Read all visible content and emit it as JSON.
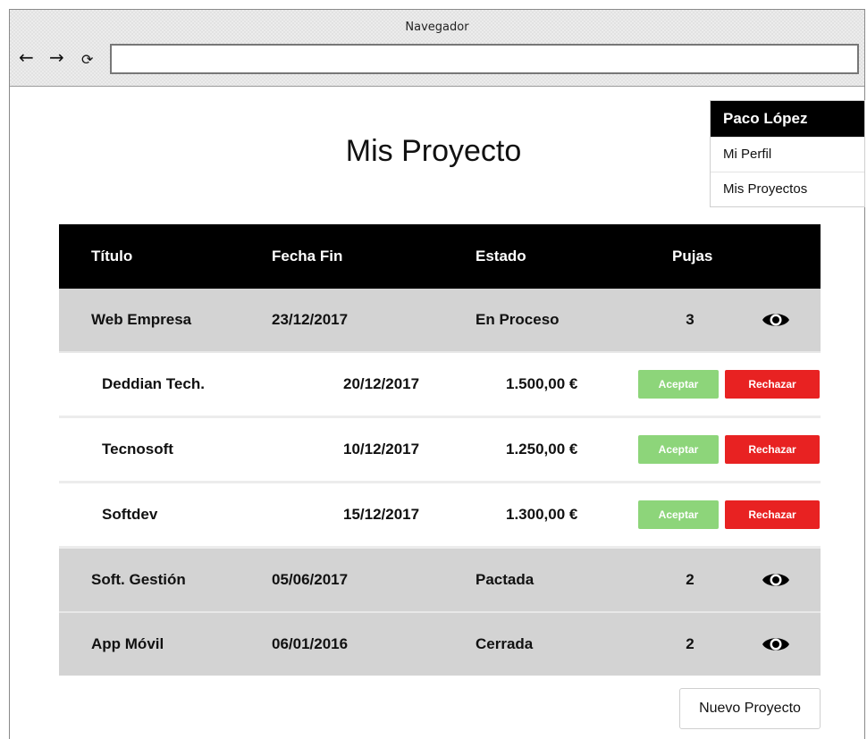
{
  "window": {
    "title": "Navegador",
    "address_value": "",
    "nav": {
      "back": "←",
      "forward": "→",
      "reload": "⟳"
    }
  },
  "page": {
    "title": "Mis Proyecto"
  },
  "user_menu": {
    "name": "Paco López",
    "items": [
      "Mi Perfil",
      "Mis Proyectos"
    ]
  },
  "table": {
    "headers": {
      "title": "Título",
      "end_date": "Fecha Fin",
      "state": "Estado",
      "bids": "Pujas"
    },
    "projects": [
      {
        "title": "Web Empresa",
        "end_date": "23/12/2017",
        "state": "En Proceso",
        "bids": "3",
        "action_icon": "eye-icon",
        "bid_list": [
          {
            "company": "Deddian Tech.",
            "date": "20/12/2017",
            "amount": "1.500,00 €",
            "accept": "Aceptar",
            "reject": "Rechazar"
          },
          {
            "company": "Tecnosoft",
            "date": "10/12/2017",
            "amount": "1.250,00 €",
            "accept": "Aceptar",
            "reject": "Rechazar"
          },
          {
            "company": "Softdev",
            "date": "15/12/2017",
            "amount": "1.300,00 €",
            "accept": "Aceptar",
            "reject": "Rechazar"
          }
        ]
      },
      {
        "title": "Soft. Gestión",
        "end_date": "05/06/2017",
        "state": "Pactada",
        "bids": "2",
        "action_icon": "eye-icon"
      },
      {
        "title": "App Móvil",
        "end_date": "06/01/2016",
        "state": "Cerrada",
        "bids": "2",
        "action_icon": "eye-icon"
      }
    ]
  },
  "actions": {
    "new_project": "Nuevo Proyecto"
  },
  "colors": {
    "header_bg": "#000000",
    "project_row_bg": "#d3d3d3",
    "accept": "#8dd57a",
    "reject": "#e82222"
  }
}
